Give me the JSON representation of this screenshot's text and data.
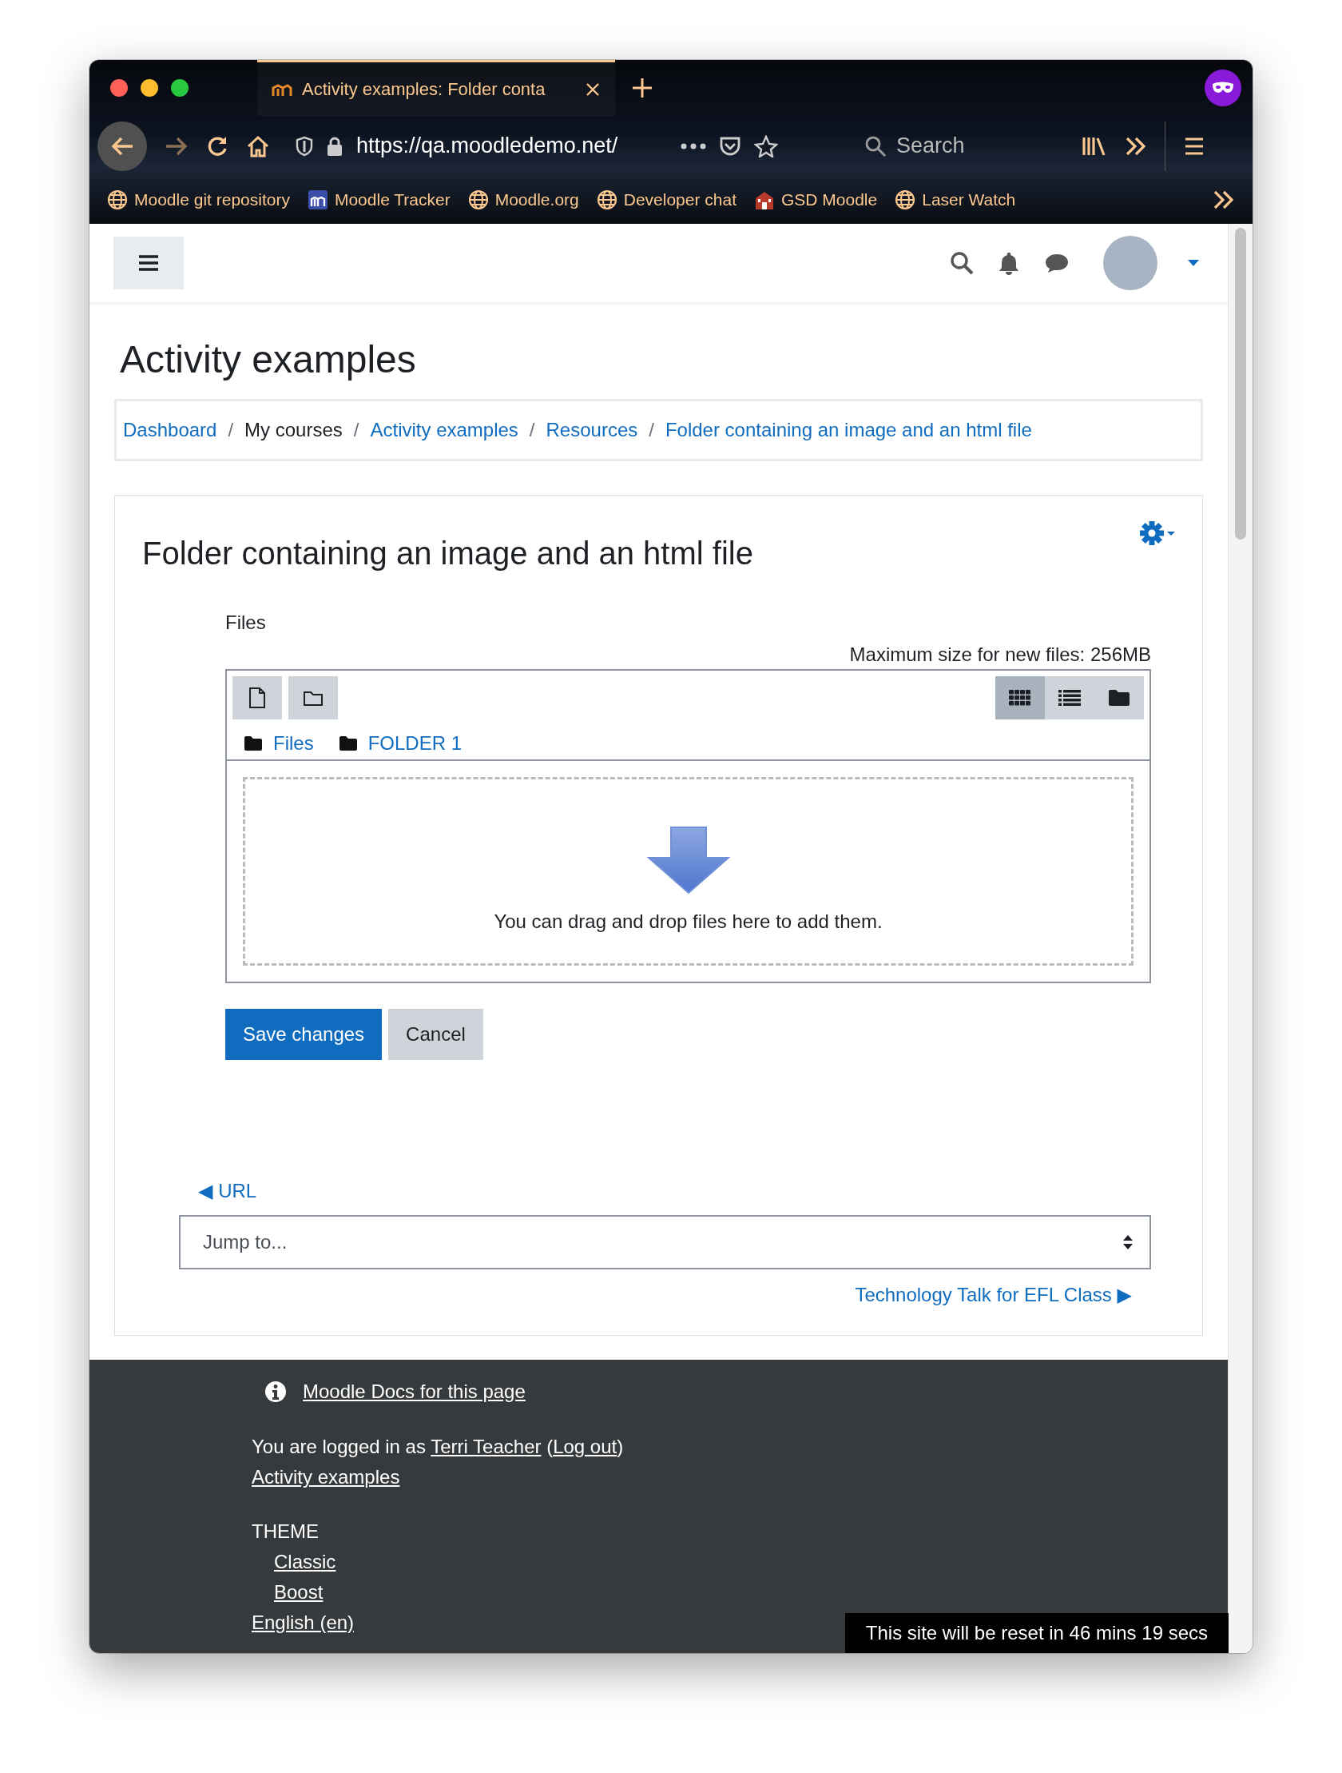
{
  "browser": {
    "tabs": [
      {
        "title": "Activity examples: Folder conta",
        "selected": true
      }
    ],
    "url": "https://qa.moodledemo.net/",
    "search": {
      "placeholder": "Search"
    },
    "bookmarks": [
      {
        "label": "Moodle git repository",
        "kind": "globe"
      },
      {
        "label": "Moodle Tracker",
        "kind": "tracker"
      },
      {
        "label": "Moodle.org",
        "kind": "globe"
      },
      {
        "label": "Developer chat",
        "kind": "globe"
      },
      {
        "label": "GSD Moodle",
        "kind": "school"
      },
      {
        "label": "Laser Watch",
        "kind": "globe"
      }
    ]
  },
  "page": {
    "heading": "Activity examples",
    "breadcrumb": [
      {
        "label": "Dashboard",
        "link": true
      },
      {
        "label": "My courses",
        "link": false
      },
      {
        "label": "Activity examples",
        "link": true
      },
      {
        "label": "Resources",
        "link": true
      },
      {
        "label": "Folder containing an image and an html file",
        "link": true
      }
    ],
    "separator": "/",
    "card": {
      "title": "Folder containing an image and an html file",
      "files_label": "Files",
      "max_size": "Maximum size for new files: 256MB",
      "path": [
        "Files",
        "FOLDER 1"
      ],
      "views": [
        {
          "kind": "icons",
          "selected": true
        },
        {
          "kind": "list",
          "selected": false
        },
        {
          "kind": "tree",
          "selected": false
        }
      ],
      "drop_hint": "You can drag and drop files here to add them.",
      "buttons": [
        {
          "label": "Save changes",
          "kind": "primary"
        },
        {
          "label": "Cancel",
          "kind": "secondary"
        }
      ],
      "prev_link": "◀ URL",
      "jump": {
        "placeholder": "Jump to..."
      },
      "next_link": "Technology Talk for EFL Class ▶"
    }
  },
  "footer": {
    "docs_link": "Moodle Docs for this page",
    "login": {
      "before": "You are logged in as ",
      "user": "Terri Teacher",
      "between": " (",
      "logout": "Log out",
      "after": ")"
    },
    "course_link": "Activity examples",
    "theme_heading": "THEME",
    "themes": [
      "Classic",
      "Boost"
    ],
    "language": "English (en)",
    "reset_notice": "This site will be reset in 46 mins 19 secs"
  }
}
